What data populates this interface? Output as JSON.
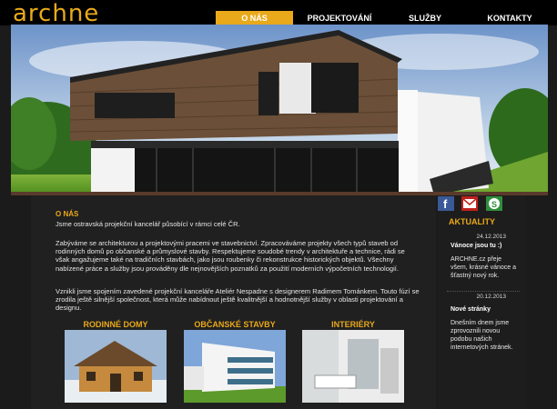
{
  "logo": {
    "text": "ARCHNE"
  },
  "nav": [
    "O NÁS",
    "PROJEKTOVÁNÍ",
    "SLUŽBY",
    "KONTAKTY"
  ],
  "social": [
    "facebook-icon",
    "email-icon",
    "skype-icon"
  ],
  "about": {
    "title": "O NÁS",
    "p1": "Jsme ostravská projekční kancelář působící v rámci celé ČR.",
    "p2": "Zabýváme se architekturou a projektovými pracemi ve stavebnictví. Zpracováváme projekty všech typů staveb od rodinných domů po občanské a průmyslové stavby. Respektujeme soudobé trendy v architektuře a technice, rádi se však angažujeme také na tradičních stavbách, jako jsou roubenky či rekonstrukce historických objektů. Všechny nabízené práce a služby jsou prováděny dle nejnovějších poznatků za použití moderních výpočetních technologií.",
    "p3": "Vznikli jsme spojením zavedené projekční kanceláře Ateliér Nespadne s designerem Radimem Tománkem. Touto fúzí se zrodila ještě silnější společnost, která může nabídnout ještě kvalitnější a hodnotnější služby v oblasti projektování a designu."
  },
  "categories": [
    "RODINNÉ DOMY",
    "OBČANSKÉ STAVBY",
    "INTERIÉRY"
  ],
  "aktuality": {
    "title": "AKTUALITY",
    "items": [
      {
        "date": "24.12.2013",
        "title": "Vánoce jsou tu :)",
        "text": "ARCHNE.cz přeje všem, krásné vánoce a šťastný nový rok."
      },
      {
        "date": "20.12.2013",
        "title": "Nové stránky",
        "text": "Dnešním dnem jsme zprovoznili novou podobu našich internetových stránek."
      }
    ]
  },
  "colors": {
    "accent": "#e9a91b",
    "background": "#1b1b1b"
  }
}
